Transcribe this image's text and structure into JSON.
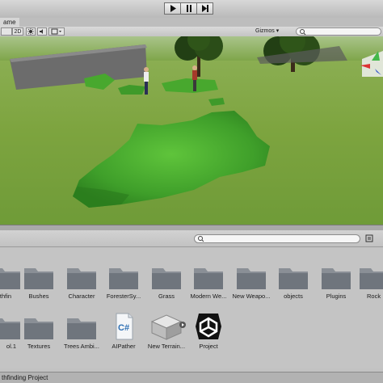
{
  "toolbar": {
    "play": "play-icon",
    "pause": "pause-icon",
    "step": "step-icon"
  },
  "tabs": {
    "game": "ame"
  },
  "scene_toolbar": {
    "mode": "2D",
    "gizmos": "Gizmos",
    "gizmos_arrow": "▾"
  },
  "project": {
    "row1": [
      "thfin",
      "Bushes",
      "Character",
      "ForesterSy...",
      "Grass",
      "Modern We...",
      "New Weapo...",
      "objects",
      "Plugins",
      "Rock"
    ],
    "row2": [
      "ol.1",
      "Textures",
      "Trees Ambi...",
      "AIPather",
      "New Terrain...",
      "Project"
    ],
    "csharp_badge": "C#"
  },
  "footer": {
    "text": "thfinding Project"
  }
}
